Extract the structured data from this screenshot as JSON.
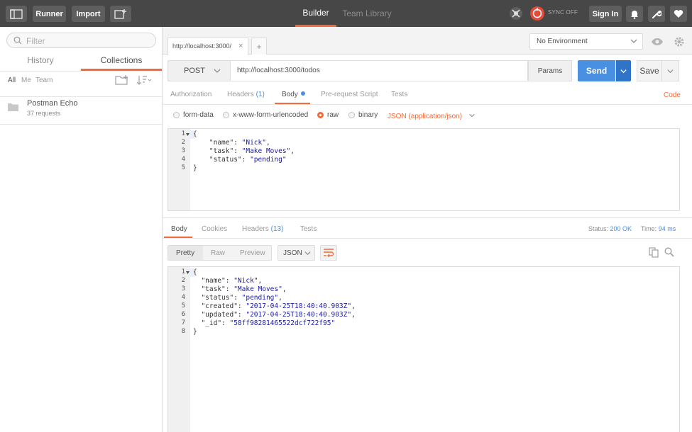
{
  "topbar": {
    "runner_label": "Runner",
    "import_label": "Import",
    "tabs": [
      {
        "label": "Builder"
      },
      {
        "label": "Team Library"
      }
    ],
    "sync_label": "SYNC OFF",
    "signin_label": "Sign In"
  },
  "sidebar": {
    "filter_placeholder": "Filter",
    "tabs": [
      {
        "label": "History"
      },
      {
        "label": "Collections"
      }
    ],
    "filters": [
      "All",
      "Me",
      "Team"
    ],
    "collections": [
      {
        "name": "Postman Echo",
        "count": "37 requests"
      }
    ]
  },
  "main": {
    "request_tab": {
      "title": "http://localhost:3000/",
      "close": "×"
    },
    "new_tab": "+",
    "environment": "No Environment",
    "method": "POST",
    "url": "http://localhost:3000/todos",
    "params_label": "Params",
    "send_label": "Send",
    "save_label": "Save",
    "request_tabs": [
      {
        "label": "Authorization"
      },
      {
        "label": "Headers",
        "count": "(1)"
      },
      {
        "label": "Body"
      },
      {
        "label": "Pre-request Script"
      },
      {
        "label": "Tests"
      }
    ],
    "code_label": "Code",
    "body_types": [
      {
        "label": "form-data"
      },
      {
        "label": "x-www-form-urlencoded"
      },
      {
        "label": "raw"
      },
      {
        "label": "binary"
      }
    ],
    "content_type": "JSON (application/json)",
    "request_body": {
      "line_numbers": [
        "1",
        "2",
        "3",
        "4",
        "5"
      ],
      "lines": [
        {
          "text": "{"
        },
        {
          "key": "    \"name\": ",
          "value": "\"Nick\"",
          "tail": ","
        },
        {
          "key": "    \"task\": ",
          "value": "\"Make Moves\"",
          "tail": ","
        },
        {
          "key": "    \"status\": ",
          "value": "\"pending\"",
          "tail": ""
        },
        {
          "text": "}"
        }
      ]
    },
    "response_tabs": [
      {
        "label": "Body"
      },
      {
        "label": "Cookies"
      },
      {
        "label": "Headers",
        "count": "(13)"
      },
      {
        "label": "Tests"
      }
    ],
    "status": {
      "label": "Status:",
      "value": "200 OK"
    },
    "time": {
      "label": "Time:",
      "value": "94 ms"
    },
    "formats": [
      "Pretty",
      "Raw",
      "Preview"
    ],
    "language": "JSON",
    "response_body": {
      "line_numbers": [
        "1",
        "2",
        "3",
        "4",
        "5",
        "6",
        "7",
        "8"
      ],
      "lines": [
        {
          "text": "{"
        },
        {
          "key": "  \"name\": ",
          "value": "\"Nick\"",
          "tail": ","
        },
        {
          "key": "  \"task\": ",
          "value": "\"Make Moves\"",
          "tail": ","
        },
        {
          "key": "  \"status\": ",
          "value": "\"pending\"",
          "tail": ","
        },
        {
          "key": "  \"created\": ",
          "value": "\"2017-04-25T18:40:40.903Z\"",
          "tail": ","
        },
        {
          "key": "  \"updated\": ",
          "value": "\"2017-04-25T18:40:40.903Z\"",
          "tail": ","
        },
        {
          "key": "  \"_id\": ",
          "value": "\"58ff98281465522dcf722f95\"",
          "tail": ""
        },
        {
          "text": "}"
        }
      ]
    }
  },
  "colors": {
    "accent": "#f26b3a",
    "send": "#4a90e2",
    "topbar": "#474747"
  }
}
